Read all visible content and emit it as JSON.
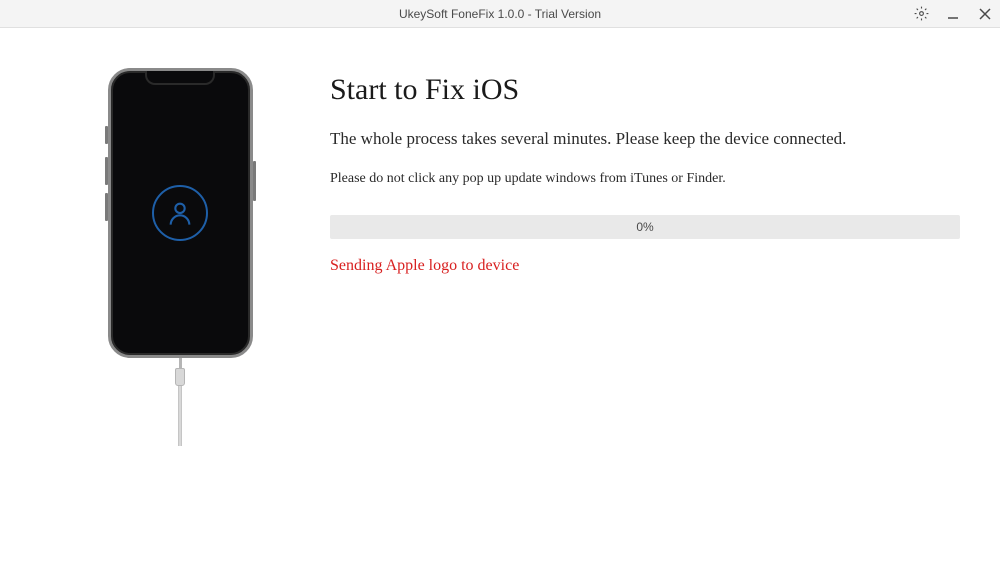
{
  "window": {
    "title": "UkeySoft FoneFix 1.0.0 - Trial Version"
  },
  "content": {
    "heading": "Start to Fix iOS",
    "subheading": "The whole process takes several minutes. Please keep the device connected.",
    "warning": "Please do not click any pop up update windows from iTunes or Finder.",
    "progress_percent": "0%",
    "status": "Sending Apple logo to device"
  },
  "icons": {
    "settings": "gear-icon",
    "minimize": "minimize-icon",
    "close": "close-icon",
    "user": "user-icon"
  }
}
